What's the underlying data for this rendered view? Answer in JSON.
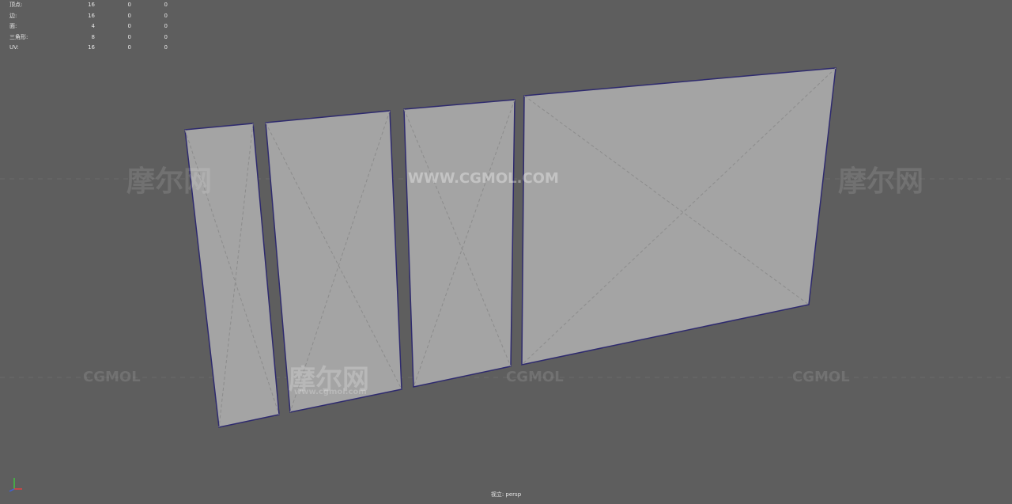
{
  "hud": {
    "rows": [
      {
        "label": "顶点:",
        "v1": "16",
        "v2": "0",
        "v3": "0"
      },
      {
        "label": "边:",
        "v1": "16",
        "v2": "0",
        "v3": "0"
      },
      {
        "label": "面:",
        "v1": "4",
        "v2": "0",
        "v3": "0"
      },
      {
        "label": "三角形:",
        "v1": "8",
        "v2": "0",
        "v3": "0"
      },
      {
        "label": "UV:",
        "v1": "16",
        "v2": "0",
        "v3": "0"
      }
    ]
  },
  "viewport": {
    "camera_label": "视立: persp",
    "background_color": "#5e5e5e",
    "panel_fill": "#a4a4a4",
    "panel_edge": "#2e2a6e"
  },
  "watermarks": {
    "url": "WWW.CGMOL.COM",
    "brand": "CGMOL",
    "cn": "摩尔网",
    "url_lower": "www.cgmol.com"
  },
  "gizmo": {
    "icon": "axis-gizmo-icon",
    "x_color": "#e04040",
    "y_color": "#40c040",
    "z_color": "#4060e0"
  }
}
